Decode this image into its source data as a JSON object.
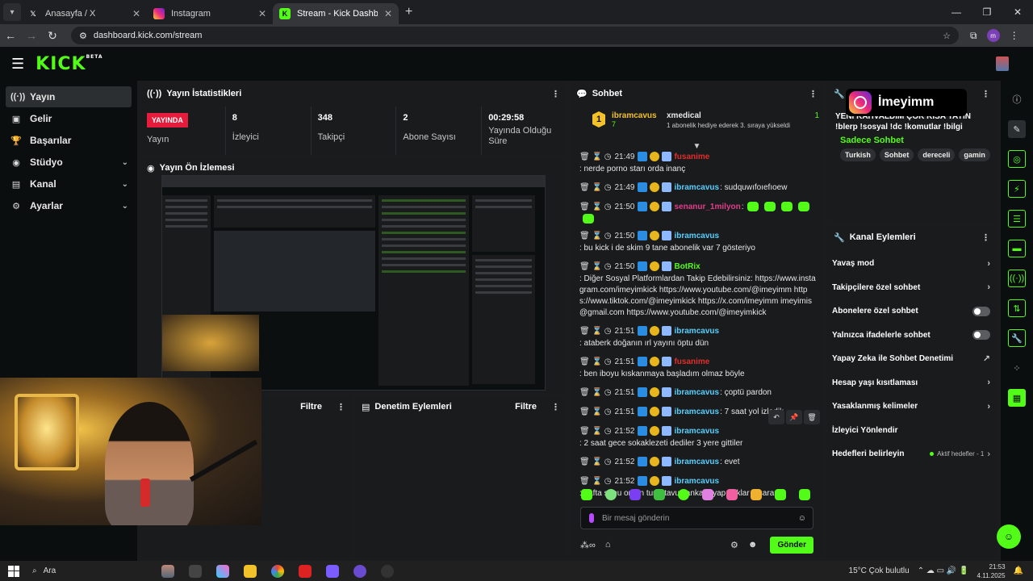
{
  "browser": {
    "tabs": [
      {
        "title": "Anasayfa / X",
        "icon": "x-logo-icon",
        "active": false
      },
      {
        "title": "Instagram",
        "icon": "instagram-icon",
        "active": false
      },
      {
        "title": "Stream - Kick Dashboard",
        "icon": "kick-icon",
        "active": true
      }
    ],
    "url": "dashboard.kick.com/stream",
    "profile_initial": "m"
  },
  "kick": {
    "logo": "KICK",
    "logo_sup": "BETA"
  },
  "sidebar": {
    "items": [
      {
        "label": "Yayın",
        "icon": "broadcast-icon",
        "active": true,
        "chevron": false
      },
      {
        "label": "Gelir",
        "icon": "wallet-icon",
        "active": false,
        "chevron": false
      },
      {
        "label": "Başarılar",
        "icon": "trophy-icon",
        "active": false,
        "chevron": false
      },
      {
        "label": "Stüdyo",
        "icon": "studio-icon",
        "active": false,
        "chevron": true
      },
      {
        "label": "Kanal",
        "icon": "channel-icon",
        "active": false,
        "chevron": true
      },
      {
        "label": "Ayarlar",
        "icon": "gear-icon",
        "active": false,
        "chevron": true
      }
    ]
  },
  "stats": {
    "title": "Yayın İstatistikleri",
    "live_badge": "YAYINDA",
    "live_label": "Yayın",
    "items": [
      {
        "value": "8",
        "label": "İzleyici"
      },
      {
        "value": "348",
        "label": "Takipçi"
      },
      {
        "value": "2",
        "label": "Abone Sayısı"
      },
      {
        "value": "00:29:58",
        "label": "Yayında Olduğu Süre"
      }
    ]
  },
  "preview": {
    "title": "Yayın Ön İzlemesi"
  },
  "bottom_panels": {
    "left_filter": "Filtre",
    "mod_title": "Denetim Eylemleri",
    "mod_filter": "Filtre"
  },
  "chat": {
    "title": "Sohbet",
    "pinned": {
      "rank": "1",
      "user": "ibramcavus",
      "user_sub": "7",
      "gifter": "xmedical",
      "gift_count": "1",
      "gift_text": "1 abonelik hediye ederek 3. sıraya yükseldi"
    },
    "messages": [
      {
        "time": "21:49",
        "name": "fusanime",
        "color": "#e32d2d",
        "text": ": nerde porno starı orda inanç"
      },
      {
        "time": "21:49",
        "name": "ibramcavus",
        "color": "#53d0ff",
        "text": ": sudquwıfoıefıoew"
      },
      {
        "time": "21:50",
        "name": "senanur_1milyon",
        "color": "#e33c8a",
        "text": ":"
      },
      {
        "time": "21:50",
        "name": "ibramcavus",
        "color": "#53d0ff",
        "text": ": bu kick i de skim 9 tane abonelik var 7 gösteriyo"
      },
      {
        "time": "21:50",
        "name": "BotRix",
        "color": "#53fc18",
        "text": ": Diğer Sosyal Platformlardan Takip Edebilirsiniz: https://www.instagram.com/imeyimkick https://www.youtube.com/@imeyimm https://www.tiktok.com/@imeyimkick https://x.com/imeyimm imeyimis@gmail.com https://www.youtube.com/@imeyimkick"
      },
      {
        "time": "21:51",
        "name": "ibramcavus",
        "color": "#53d0ff",
        "text": ": ataberk doğanın ırl yayını öptu dün"
      },
      {
        "time": "21:51",
        "name": "fusanime",
        "color": "#e32d2d",
        "text": ": ben iboyu kıskanmaya başladım olmaz böyle"
      },
      {
        "time": "21:51",
        "name": "ibramcavus",
        "color": "#53d0ff",
        "text": ": çoptü pardon"
      },
      {
        "time": "21:51",
        "name": "ibramcavus",
        "color": "#53d0ff",
        "text": ": 7 saat yol izledik"
      },
      {
        "time": "21:52",
        "name": "ibramcavus",
        "color": "#53d0ff",
        "text": ": 2 saat gece sokaklezeti dediler 3 yere gittiler"
      },
      {
        "time": "21:52",
        "name": "ibramcavus",
        "color": "#53d0ff",
        "text": ": evet"
      },
      {
        "time": "21:52",
        "name": "ibramcavus",
        "color": "#53d0ff",
        "text": ": hafta sonu orkun tuna tavus ankara yapıcaklar o sarar"
      },
      {
        "time": "21:52",
        "name": "@yalesa3",
        "color": "#e32d2d",
        "text": ": 💛❤"
      }
    ],
    "input_placeholder": "Bir mesaj gönderin",
    "send_label": "Gönder"
  },
  "stream_info": {
    "title": "YENİ KAHVALDIM ÇOK KISA YAYIN !blerp !sosyal !dc !komutlar !bilgi",
    "category": "Sadece Sohbet",
    "tags": [
      "Turkish",
      "Sohbet",
      "dereceli",
      "gamin"
    ],
    "overlay_name": "İmeyimm"
  },
  "channel_actions": {
    "title": "Kanal Eylemleri",
    "items": [
      {
        "label": "Yavaş mod",
        "type": "arrow"
      },
      {
        "label": "Takipçilere özel sohbet",
        "type": "arrow"
      },
      {
        "label": "Abonelere özel sohbet",
        "type": "toggle"
      },
      {
        "label": "Yalnızca ifadelerle sohbet",
        "type": "toggle"
      },
      {
        "label": "Yapay Zeka ile Sohbet Denetimi",
        "type": "external"
      },
      {
        "label": "Hesap yaşı kısıtlaması",
        "type": "arrow"
      },
      {
        "label": "Yasaklanmış kelimeler",
        "type": "arrow"
      },
      {
        "label": "İzleyici Yönlendir",
        "type": "none"
      },
      {
        "label": "Hedefleri belirleyin",
        "type": "goal",
        "sub": "Aktif hedefler - 1"
      }
    ]
  },
  "taskbar": {
    "search": "Ara",
    "weather": "15°C  Çok bulutlu",
    "time": "21:53",
    "date": "4.11.2025"
  },
  "colors": {
    "accent": "#53fc18",
    "live": "#e51c3c",
    "bg": "#0b0e0f",
    "panel": "#191b1c"
  }
}
